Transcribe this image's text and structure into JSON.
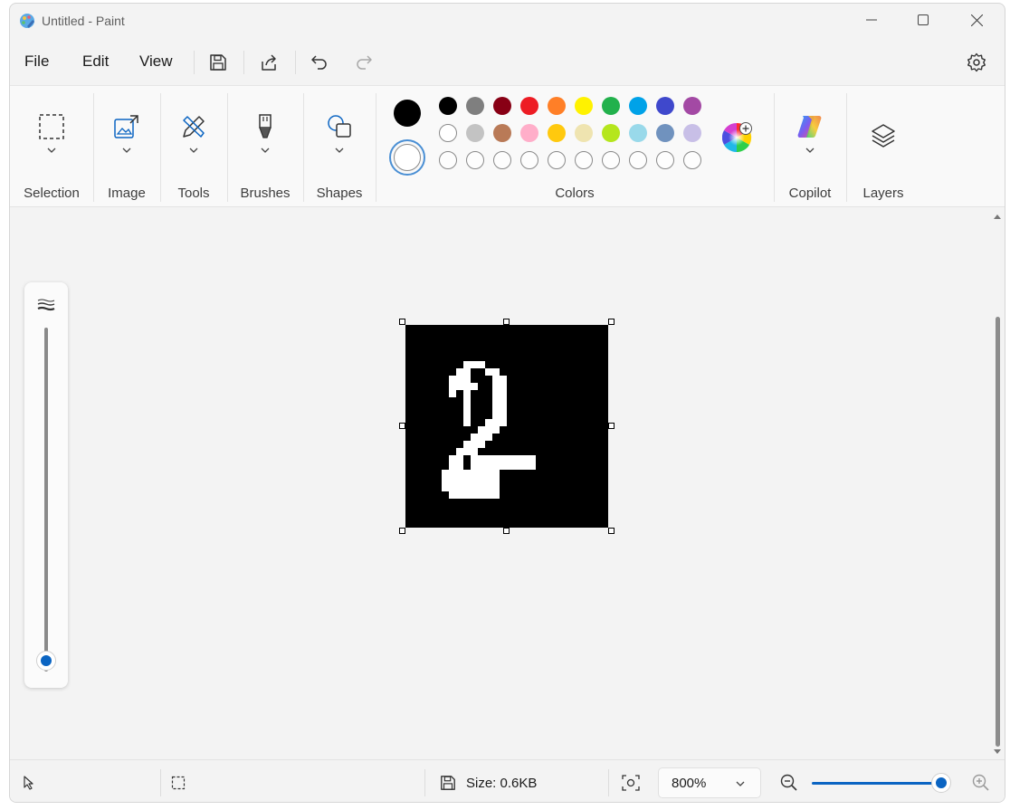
{
  "window": {
    "title": "Untitled - Paint"
  },
  "menu": {
    "file": "File",
    "edit": "Edit",
    "view": "View"
  },
  "ribbon": {
    "groups": {
      "selection": "Selection",
      "image": "Image",
      "tools": "Tools",
      "brushes": "Brushes",
      "shapes": "Shapes",
      "colors": "Colors",
      "copilot": "Copilot",
      "layers": "Layers"
    },
    "primary_color": "#000000",
    "secondary_color": "#ffffff",
    "palette_row1": [
      "#000000",
      "#7f7f7f",
      "#880015",
      "#ed1c24",
      "#ff7f27",
      "#fff200",
      "#22b14c",
      "#00a2e8",
      "#3f48cc",
      "#a349a4"
    ],
    "palette_row2": [
      "#ffffff",
      "#c3c3c3",
      "#b97a57",
      "#ffaec9",
      "#ffc90e",
      "#efe4b0",
      "#b5e61d",
      "#99d9ea",
      "#7092be",
      "#c8bfe7"
    ],
    "palette_row3_empty_count": 10
  },
  "canvas": {
    "digit": "2",
    "background": "#000000",
    "foreground": "#ffffff"
  },
  "status": {
    "size": "Size: 0.6KB",
    "zoom": "800%",
    "zoom_fraction": 0.95
  },
  "accent": "#0a64c2"
}
